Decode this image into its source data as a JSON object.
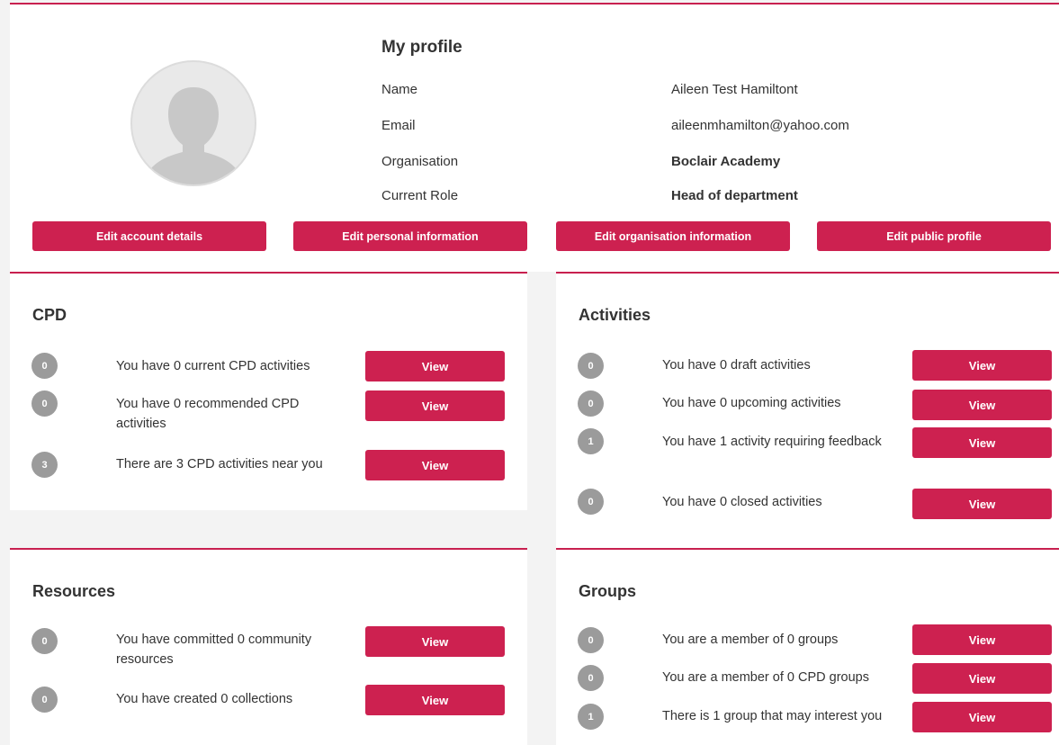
{
  "profile": {
    "title": "My profile",
    "fields": [
      {
        "label": "Name",
        "value": "Aileen Test Hamiltont"
      },
      {
        "label": "Email",
        "value": "aileenmhamilton@yahoo.com"
      },
      {
        "label": "Organisation",
        "value": "Boclair Academy"
      },
      {
        "label": "Current Role",
        "value": "Head of department"
      }
    ],
    "buttons": [
      "Edit account details",
      "Edit personal information",
      "Edit organisation information",
      "Edit public profile"
    ]
  },
  "cpd": {
    "title": "CPD",
    "rows": [
      {
        "count": "0",
        "text": "You have 0 current CPD activities",
        "button": "View"
      },
      {
        "count": "0",
        "text": "You have 0 recommended CPD activities",
        "button": "View"
      },
      {
        "count": "3",
        "text": "There are 3 CPD activities near you",
        "button": "View"
      }
    ]
  },
  "activities": {
    "title": "Activities",
    "rows": [
      {
        "count": "0",
        "text": "You have 0 draft activities",
        "button": "View"
      },
      {
        "count": "0",
        "text": "You have 0 upcoming activities",
        "button": "View"
      },
      {
        "count": "1",
        "text": "You have 1 activity requiring feedback",
        "button": "View"
      },
      {
        "count": "0",
        "text": "You have 0 closed activities",
        "button": "View"
      }
    ]
  },
  "resources": {
    "title": "Resources",
    "rows": [
      {
        "count": "0",
        "text": "You have committed 0 community resources",
        "button": "View"
      },
      {
        "count": "0",
        "text": "You have created 0 collections",
        "button": "View"
      }
    ]
  },
  "groups": {
    "title": "Groups",
    "rows": [
      {
        "count": "0",
        "text": "You are a member of 0 groups",
        "button": "View"
      },
      {
        "count": "0",
        "text": "You are a member of 0 CPD groups",
        "button": "View"
      },
      {
        "count": "1",
        "text": "There is 1 group that may interest you",
        "button": "View"
      }
    ]
  },
  "colors": {
    "accent": "#cd2150",
    "badge": "#9b9b9b",
    "background": "#f3f3f3"
  }
}
